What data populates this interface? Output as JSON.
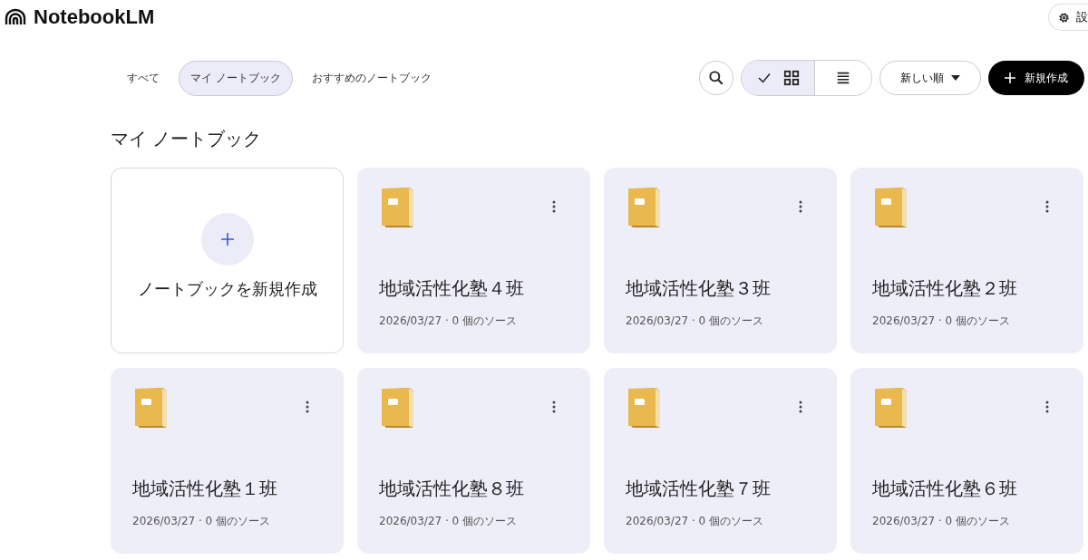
{
  "app": {
    "name": "NotebookLM",
    "settings_label": "設"
  },
  "filter_tabs": [
    {
      "label": "すべて",
      "selected": false
    },
    {
      "label": "マイ ノートブック",
      "selected": true
    },
    {
      "label": "おすすめのノートブック",
      "selected": false
    }
  ],
  "view_toggle": [
    {
      "kind": "grid",
      "selected": true
    },
    {
      "kind": "list",
      "selected": false
    }
  ],
  "sort": {
    "label": "新しい順"
  },
  "create_button": {
    "label": "新規作成"
  },
  "section_title": "マイ ノートブック",
  "new_notebook_card": {
    "label": "ノートブックを新規作成"
  },
  "notebooks": [
    {
      "title": "地域活性化塾４班",
      "meta": "2026/03/27 · 0 個のソース"
    },
    {
      "title": "地域活性化塾３班",
      "meta": "2026/03/27 · 0 個のソース"
    },
    {
      "title": "地域活性化塾２班",
      "meta": "2026/03/27 · 0 個のソース"
    },
    {
      "title": "地域活性化塾１班",
      "meta": "2026/03/27 · 0 個のソース"
    },
    {
      "title": "地域活性化塾８班",
      "meta": "2026/03/27 · 0 個のソース"
    },
    {
      "title": "地域活性化塾７班",
      "meta": "2026/03/27 · 0 個のソース"
    },
    {
      "title": "地域活性化塾６班",
      "meta": "2026/03/27 · 0 個のソース"
    }
  ]
}
